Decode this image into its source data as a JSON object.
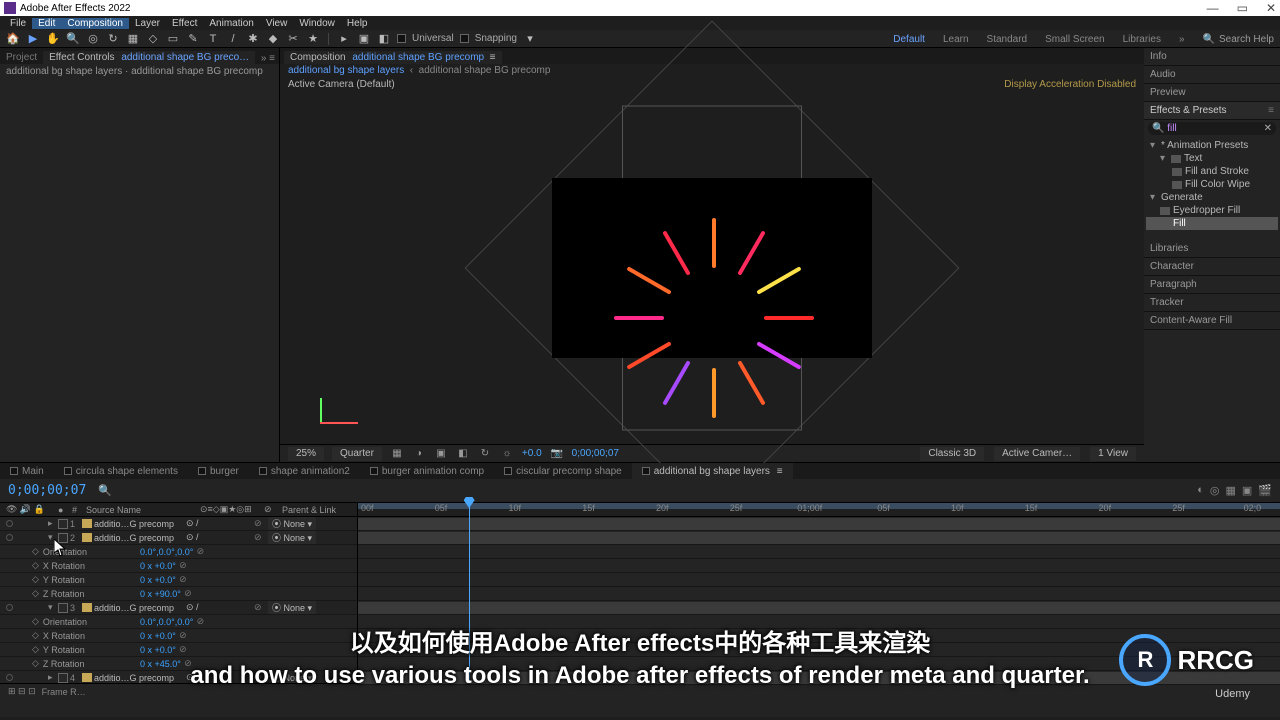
{
  "app_title": "Adobe After Effects 2022",
  "menu": [
    "File",
    "Edit",
    "Composition",
    "Layer",
    "Effect",
    "Animation",
    "View",
    "Window",
    "Help"
  ],
  "toolbar": {
    "universal": "Universal",
    "snapping": "Snapping",
    "workspaces": [
      "Default",
      "Learn",
      "Standard",
      "Small Screen",
      "Libraries"
    ],
    "search_placeholder": "Search Help"
  },
  "left_panel": {
    "tab_project": "Project",
    "tab_effectcontrols": "Effect Controls",
    "link_name": "additional shape BG preco…",
    "sub": "additional bg shape layers · additional shape BG precomp"
  },
  "comp_panel": {
    "tab_label": "Composition",
    "tab_link": "additional shape BG precomp",
    "bread1": "additional bg shape layers",
    "bread2": "additional shape BG precomp",
    "active_camera": "Active Camera (Default)",
    "accel_msg": "Display Acceleration Disabled"
  },
  "viewer_bar": {
    "zoom": "25%",
    "res": "Quarter",
    "time": "+0.0",
    "timecode": "0;00;00;07",
    "renderer": "Classic 3D",
    "camera": "Active Camer…",
    "views": "1 View"
  },
  "right_panels": {
    "info": "Info",
    "audio": "Audio",
    "preview": "Preview",
    "ep": "Effects & Presets",
    "ep_search": "fill",
    "ep_tree": {
      "anim_presets": "* Animation Presets",
      "text": "Text",
      "fill_and_stroke": "Fill and Stroke",
      "fill_color_wipe": "Fill Color Wipe",
      "generate": "Generate",
      "eyedropper": "Eyedropper Fill",
      "fill": "Fill"
    },
    "libraries": "Libraries",
    "character": "Character",
    "paragraph": "Paragraph",
    "tracker": "Tracker",
    "contentaware": "Content-Aware Fill"
  },
  "timeline": {
    "tabs": [
      "Main",
      "circula shape elements",
      "burger",
      "shape animation2",
      "burger animation comp",
      "ciscular precomp shape",
      "additional bg shape layers"
    ],
    "active_tab": 6,
    "timecode": "0;00;00;07",
    "src_header": "Source Name",
    "parent_header": "Parent & Link",
    "none": "None",
    "layers": [
      {
        "idx": 1,
        "name": "additio…G precomp",
        "expanded": false,
        "parent": "None"
      },
      {
        "idx": 2,
        "name": "additio…G precomp",
        "expanded": true,
        "parent": "None"
      },
      {
        "idx": 3,
        "name": "additio…G precomp",
        "expanded": true,
        "parent": "None"
      },
      {
        "idx": 4,
        "name": "additio…G precomp",
        "expanded": false,
        "parent": "None"
      }
    ],
    "props2": [
      {
        "name": "Orientation",
        "val": "0.0°,0.0°,0.0°"
      },
      {
        "name": "X Rotation",
        "val": "0 x +0.0°"
      },
      {
        "name": "Y Rotation",
        "val": "0 x +0.0°"
      },
      {
        "name": "Z Rotation",
        "val": "0 x +90.0°"
      }
    ],
    "props3": [
      {
        "name": "Orientation",
        "val": "0.0°,0.0°,0.0°"
      },
      {
        "name": "X Rotation",
        "val": "0 x +0.0°"
      },
      {
        "name": "Y Rotation",
        "val": "0 x +0.0°"
      },
      {
        "name": "Z Rotation",
        "val": "0 x +45.0°"
      }
    ],
    "ruler": [
      "00f",
      "05f",
      "10f",
      "15f",
      "20f",
      "25f",
      "01;00f",
      "05f",
      "10f",
      "15f",
      "20f",
      "25f",
      "02;0"
    ],
    "footer": "Frame R…"
  },
  "subtitles": {
    "s1": "以及如何使用Adobe After effects中的各种工具来渲染",
    "s2": "and how to use various tools in Adobe after effects of render meta and quarter."
  },
  "wm": {
    "letters": "R",
    "text": "RRCG"
  },
  "colors": {
    "rays": [
      "#ff7a2a",
      "#ff2a5e",
      "#ffe14a",
      "#ff2a2a",
      "#d63cff",
      "#ff5a2a",
      "#ff9a2a",
      "#a84aff",
      "#ff4a2a",
      "#ff2a8a",
      "#ff6a2a",
      "#ff2a4a"
    ]
  },
  "udemy": "Udemy"
}
